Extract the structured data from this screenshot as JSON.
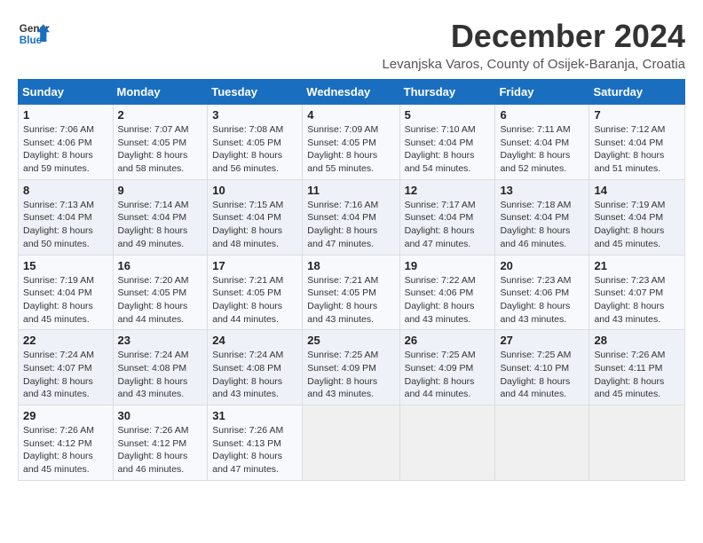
{
  "header": {
    "logo_line1": "General",
    "logo_line2": "Blue",
    "month_title": "December 2024",
    "subtitle": "Levanjska Varos, County of Osijek-Baranja, Croatia"
  },
  "weekdays": [
    "Sunday",
    "Monday",
    "Tuesday",
    "Wednesday",
    "Thursday",
    "Friday",
    "Saturday"
  ],
  "weeks": [
    [
      {
        "day": "1",
        "info": "Sunrise: 7:06 AM\nSunset: 4:06 PM\nDaylight: 8 hours\nand 59 minutes."
      },
      {
        "day": "2",
        "info": "Sunrise: 7:07 AM\nSunset: 4:05 PM\nDaylight: 8 hours\nand 58 minutes."
      },
      {
        "day": "3",
        "info": "Sunrise: 7:08 AM\nSunset: 4:05 PM\nDaylight: 8 hours\nand 56 minutes."
      },
      {
        "day": "4",
        "info": "Sunrise: 7:09 AM\nSunset: 4:05 PM\nDaylight: 8 hours\nand 55 minutes."
      },
      {
        "day": "5",
        "info": "Sunrise: 7:10 AM\nSunset: 4:04 PM\nDaylight: 8 hours\nand 54 minutes."
      },
      {
        "day": "6",
        "info": "Sunrise: 7:11 AM\nSunset: 4:04 PM\nDaylight: 8 hours\nand 52 minutes."
      },
      {
        "day": "7",
        "info": "Sunrise: 7:12 AM\nSunset: 4:04 PM\nDaylight: 8 hours\nand 51 minutes."
      }
    ],
    [
      {
        "day": "8",
        "info": "Sunrise: 7:13 AM\nSunset: 4:04 PM\nDaylight: 8 hours\nand 50 minutes."
      },
      {
        "day": "9",
        "info": "Sunrise: 7:14 AM\nSunset: 4:04 PM\nDaylight: 8 hours\nand 49 minutes."
      },
      {
        "day": "10",
        "info": "Sunrise: 7:15 AM\nSunset: 4:04 PM\nDaylight: 8 hours\nand 48 minutes."
      },
      {
        "day": "11",
        "info": "Sunrise: 7:16 AM\nSunset: 4:04 PM\nDaylight: 8 hours\nand 47 minutes."
      },
      {
        "day": "12",
        "info": "Sunrise: 7:17 AM\nSunset: 4:04 PM\nDaylight: 8 hours\nand 47 minutes."
      },
      {
        "day": "13",
        "info": "Sunrise: 7:18 AM\nSunset: 4:04 PM\nDaylight: 8 hours\nand 46 minutes."
      },
      {
        "day": "14",
        "info": "Sunrise: 7:19 AM\nSunset: 4:04 PM\nDaylight: 8 hours\nand 45 minutes."
      }
    ],
    [
      {
        "day": "15",
        "info": "Sunrise: 7:19 AM\nSunset: 4:04 PM\nDaylight: 8 hours\nand 45 minutes."
      },
      {
        "day": "16",
        "info": "Sunrise: 7:20 AM\nSunset: 4:05 PM\nDaylight: 8 hours\nand 44 minutes."
      },
      {
        "day": "17",
        "info": "Sunrise: 7:21 AM\nSunset: 4:05 PM\nDaylight: 8 hours\nand 44 minutes."
      },
      {
        "day": "18",
        "info": "Sunrise: 7:21 AM\nSunset: 4:05 PM\nDaylight: 8 hours\nand 43 minutes."
      },
      {
        "day": "19",
        "info": "Sunrise: 7:22 AM\nSunset: 4:06 PM\nDaylight: 8 hours\nand 43 minutes."
      },
      {
        "day": "20",
        "info": "Sunrise: 7:23 AM\nSunset: 4:06 PM\nDaylight: 8 hours\nand 43 minutes."
      },
      {
        "day": "21",
        "info": "Sunrise: 7:23 AM\nSunset: 4:07 PM\nDaylight: 8 hours\nand 43 minutes."
      }
    ],
    [
      {
        "day": "22",
        "info": "Sunrise: 7:24 AM\nSunset: 4:07 PM\nDaylight: 8 hours\nand 43 minutes."
      },
      {
        "day": "23",
        "info": "Sunrise: 7:24 AM\nSunset: 4:08 PM\nDaylight: 8 hours\nand 43 minutes."
      },
      {
        "day": "24",
        "info": "Sunrise: 7:24 AM\nSunset: 4:08 PM\nDaylight: 8 hours\nand 43 minutes."
      },
      {
        "day": "25",
        "info": "Sunrise: 7:25 AM\nSunset: 4:09 PM\nDaylight: 8 hours\nand 43 minutes."
      },
      {
        "day": "26",
        "info": "Sunrise: 7:25 AM\nSunset: 4:09 PM\nDaylight: 8 hours\nand 44 minutes."
      },
      {
        "day": "27",
        "info": "Sunrise: 7:25 AM\nSunset: 4:10 PM\nDaylight: 8 hours\nand 44 minutes."
      },
      {
        "day": "28",
        "info": "Sunrise: 7:26 AM\nSunset: 4:11 PM\nDaylight: 8 hours\nand 45 minutes."
      }
    ],
    [
      {
        "day": "29",
        "info": "Sunrise: 7:26 AM\nSunset: 4:12 PM\nDaylight: 8 hours\nand 45 minutes."
      },
      {
        "day": "30",
        "info": "Sunrise: 7:26 AM\nSunset: 4:12 PM\nDaylight: 8 hours\nand 46 minutes."
      },
      {
        "day": "31",
        "info": "Sunrise: 7:26 AM\nSunset: 4:13 PM\nDaylight: 8 hours\nand 47 minutes."
      },
      {
        "day": "",
        "info": ""
      },
      {
        "day": "",
        "info": ""
      },
      {
        "day": "",
        "info": ""
      },
      {
        "day": "",
        "info": ""
      }
    ]
  ]
}
